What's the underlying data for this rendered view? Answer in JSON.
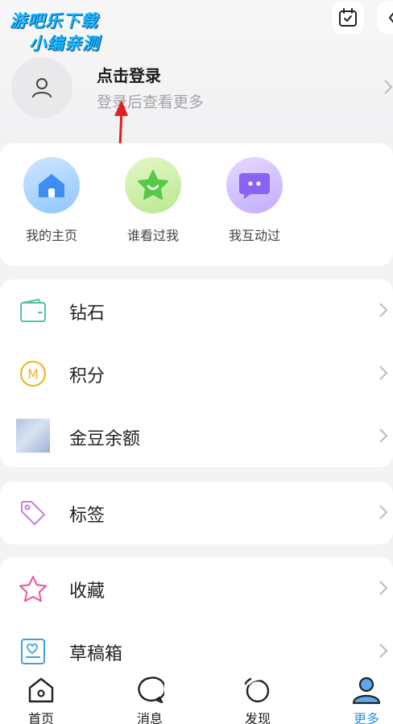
{
  "watermark": {
    "line1": "游吧乐下载",
    "line2": "小编亲测"
  },
  "header": {
    "calendar_icon": "calendar-check-icon",
    "more_icon": "more-icon"
  },
  "login": {
    "title": "点击登录",
    "subtitle": "登录后查看更多"
  },
  "quick_actions": [
    {
      "label": "我的主页",
      "icon": "home-icon",
      "color": "#3d8ef2"
    },
    {
      "label": "谁看过我",
      "icon": "star-smile-icon",
      "color": "#57c94a"
    },
    {
      "label": "我互动过",
      "icon": "chat-bubble-icon",
      "color": "#8a63f5"
    }
  ],
  "wallet": {
    "items": [
      {
        "label": "钻石",
        "icon": "wallet-icon"
      },
      {
        "label": "积分",
        "icon": "points-coin-icon",
        "coin_letter": "M"
      },
      {
        "label": "金豆余额",
        "icon": "gold-bean-thumbnail-icon"
      }
    ]
  },
  "tags": {
    "label": "标签",
    "icon": "tag-icon"
  },
  "collection": {
    "items": [
      {
        "label": "收藏",
        "icon": "star-outline-icon"
      },
      {
        "label": "草稿箱",
        "icon": "drafts-icon"
      }
    ]
  },
  "tabbar": {
    "tabs": [
      {
        "label": "首页",
        "icon": "home-tab-icon"
      },
      {
        "label": "消息",
        "icon": "message-tab-icon"
      },
      {
        "label": "发现",
        "icon": "discover-tab-icon"
      },
      {
        "label": "更多",
        "icon": "profile-tab-icon",
        "active": true
      }
    ],
    "active_color": "#2f8fe6"
  },
  "colors": {
    "annotation_arrow": "#e02020",
    "background": "#f3f3f5"
  }
}
